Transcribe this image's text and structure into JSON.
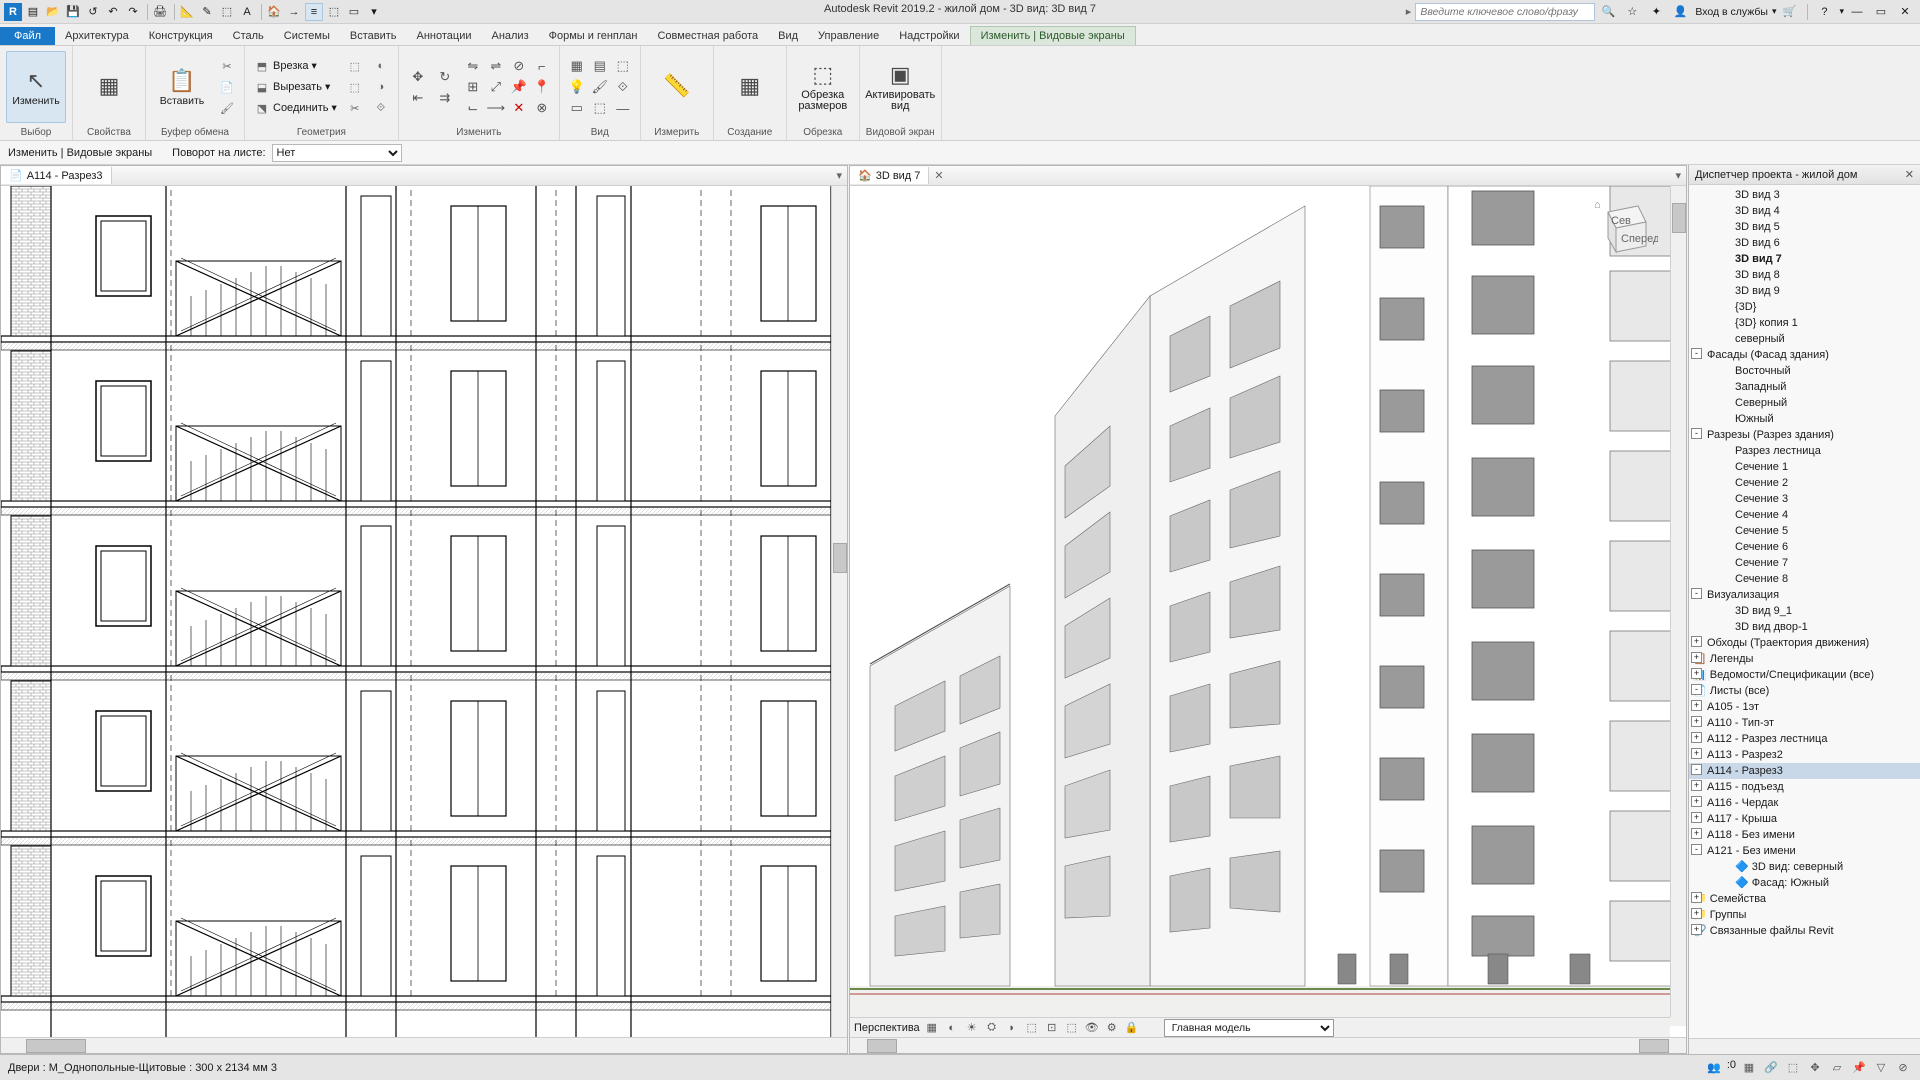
{
  "app": {
    "title": "Autodesk Revit 2019.2 - жилой дом - 3D вид: 3D вид 7"
  },
  "qat_search": {
    "placeholder": "Введите ключевое слово/фразу"
  },
  "login": "Вход в службы",
  "ribbon": {
    "file": "Файл",
    "tabs": [
      "Архитектура",
      "Конструкция",
      "Сталь",
      "Системы",
      "Вставить",
      "Аннотации",
      "Анализ",
      "Формы и генплан",
      "Совместная работа",
      "Вид",
      "Управление",
      "Надстройки",
      "Изменить | Видовые экраны"
    ],
    "active": "Изменить | Видовые экраны",
    "panels": {
      "p1": {
        "title": "Выбор",
        "btn": "Изменить"
      },
      "p2": {
        "title": "Свойства"
      },
      "p3": {
        "title": "Буфер обмена",
        "btn": "Вставить"
      },
      "p4": {
        "title": "Геометрия",
        "items": [
          "Врезка",
          "Вырезать",
          "Соединить"
        ]
      },
      "p5": {
        "title": "Изменить"
      },
      "p6": {
        "title": "Вид"
      },
      "p7": {
        "title": "Измерить"
      },
      "p8": {
        "title": "Создание"
      },
      "p9": {
        "title": "Обрезка",
        "btn1": "Обрезка",
        "btn2": "размеров"
      },
      "p10": {
        "title": "Видовой экран",
        "btn1": "Активировать",
        "btn2": "вид"
      }
    }
  },
  "options": {
    "label": "Изменить | Видовые экраны",
    "rot_label": "Поворот на листе:",
    "rot_value": "Нет"
  },
  "views": {
    "left": {
      "title": "А114 - Разрез3"
    },
    "right": {
      "title": "3D вид 7",
      "persp": "Перспектива",
      "main_model": "Главная модель"
    },
    "cube": {
      "a": "Сев",
      "b": "Спереди"
    }
  },
  "pbrowser": {
    "title": "Диспетчер проекта - жилой дом",
    "items": [
      {
        "l": 2,
        "t": "3D вид 3"
      },
      {
        "l": 2,
        "t": "3D вид 4"
      },
      {
        "l": 2,
        "t": "3D вид 5"
      },
      {
        "l": 2,
        "t": "3D вид 6"
      },
      {
        "l": 2,
        "t": "3D вид 7",
        "bold": true
      },
      {
        "l": 2,
        "t": "3D вид 8"
      },
      {
        "l": 2,
        "t": "3D вид 9"
      },
      {
        "l": 2,
        "t": "{3D}"
      },
      {
        "l": 2,
        "t": "{3D} копия 1"
      },
      {
        "l": 2,
        "t": "северный"
      },
      {
        "l": 1,
        "t": "Фасады (Фасад здания)",
        "exp": "-"
      },
      {
        "l": 2,
        "t": "Восточный"
      },
      {
        "l": 2,
        "t": "Западный"
      },
      {
        "l": 2,
        "t": "Северный"
      },
      {
        "l": 2,
        "t": "Южный"
      },
      {
        "l": 1,
        "t": "Разрезы (Разрез здания)",
        "exp": "-"
      },
      {
        "l": 2,
        "t": "Разрез лестница"
      },
      {
        "l": 2,
        "t": "Сечение 1"
      },
      {
        "l": 2,
        "t": "Сечение 2"
      },
      {
        "l": 2,
        "t": "Сечение 3"
      },
      {
        "l": 2,
        "t": "Сечение 4"
      },
      {
        "l": 2,
        "t": "Сечение 5"
      },
      {
        "l": 2,
        "t": "Сечение 6"
      },
      {
        "l": 2,
        "t": "Сечение 7"
      },
      {
        "l": 2,
        "t": "Сечение 8"
      },
      {
        "l": 1,
        "t": "Визуализация",
        "exp": "-"
      },
      {
        "l": 2,
        "t": "3D вид 9_1"
      },
      {
        "l": 2,
        "t": "3D вид двор-1"
      },
      {
        "l": 1,
        "t": "Обходы (Траектория движения)",
        "exp": "+"
      },
      {
        "l": 0,
        "t": "Легенды",
        "exp": "+",
        "icon": "📋"
      },
      {
        "l": 0,
        "t": "Ведомости/Спецификации (все)",
        "exp": "+",
        "icon": "📊"
      },
      {
        "l": 0,
        "t": "Листы (все)",
        "exp": "-",
        "icon": "📄"
      },
      {
        "l": 1,
        "t": "А105 - 1эт",
        "exp": "+"
      },
      {
        "l": 1,
        "t": "А110 - Тип-эт",
        "exp": "+"
      },
      {
        "l": 1,
        "t": "А112 - Разрез лестница",
        "exp": "+"
      },
      {
        "l": 1,
        "t": "А113 - Разрез2",
        "exp": "+"
      },
      {
        "l": 1,
        "t": "А114 - Разрез3",
        "exp": "-",
        "sel": true
      },
      {
        "l": 1,
        "t": "А115 - подъезд",
        "exp": "+"
      },
      {
        "l": 1,
        "t": "А116 - Чердак",
        "exp": "+"
      },
      {
        "l": 1,
        "t": "А117 - Крыша",
        "exp": "+"
      },
      {
        "l": 1,
        "t": "А118 - Без имени",
        "exp": "+"
      },
      {
        "l": 1,
        "t": "А121 - Без имени",
        "exp": "-"
      },
      {
        "l": 2,
        "t": "3D вид: северный",
        "icon": "🔷"
      },
      {
        "l": 2,
        "t": "Фасад: Южный",
        "icon": "🔷"
      },
      {
        "l": 0,
        "t": "Семейства",
        "exp": "+",
        "icon": "📁"
      },
      {
        "l": 0,
        "t": "Группы",
        "exp": "+",
        "icon": "📁"
      },
      {
        "l": 0,
        "t": "Связанные файлы Revit",
        "exp": "+",
        "icon": "🔗"
      }
    ]
  },
  "status": {
    "text": "Двери : М_Однопольные-Щитовые : 300 x 2134 мм 3",
    "zero": ":0"
  }
}
